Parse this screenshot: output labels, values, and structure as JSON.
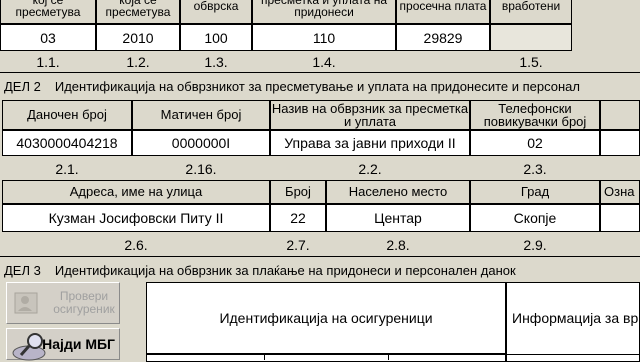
{
  "sec1": {
    "headers": [
      "кој се пресметува",
      "која се пресметува",
      "обврска",
      "пресметка и уплата на придонеси",
      "просечна плата",
      "вработени"
    ],
    "values": [
      "03",
      "2010",
      "100",
      "110",
      "29829",
      ""
    ],
    "codes": [
      "1.1.",
      "1.2.",
      "1.3.",
      "1.4.",
      "",
      "1.5."
    ]
  },
  "sec2": {
    "title": "ДЕЛ 2",
    "subtitle": "Идентификација на обврзникот за пресметување и уплата на придонесите и персонал",
    "row1_headers": [
      "Даночен број",
      "Матичен број",
      "Назив на обврзник за пресметка и уплата",
      "Телефонски повикувачки број"
    ],
    "row1_values": [
      "4030000404218",
      "0000000I",
      "Управа за јавни приходи II",
      "02"
    ],
    "row1_codes": [
      "2.1.",
      "2.16.",
      "2.2.",
      "2.3."
    ],
    "row2_headers": [
      "Адреса, име на улица",
      "Број",
      "Населено место",
      "Град",
      "Озна"
    ],
    "row2_values": [
      "Кузман Јосифовски Питу II",
      "22",
      "Центар",
      "Скопје"
    ],
    "row2_codes": [
      "2.6.",
      "2.7.",
      "2.8.",
      "2.9."
    ]
  },
  "sec3": {
    "title": "ДЕЛ 3",
    "subtitle": "Идентификација на обврзник за плаќање на придонеси и персонален данок",
    "btn_check": "Провери осигуреник",
    "btn_find": "Најди МБГ",
    "col1": "Идентификација на осигуреници",
    "col2": "Информација за вр"
  },
  "colors": {
    "background": "#dcd9cc",
    "field": "#ffffff",
    "border": "#000000"
  },
  "icons": [
    "check-user-icon",
    "find-icon"
  ]
}
